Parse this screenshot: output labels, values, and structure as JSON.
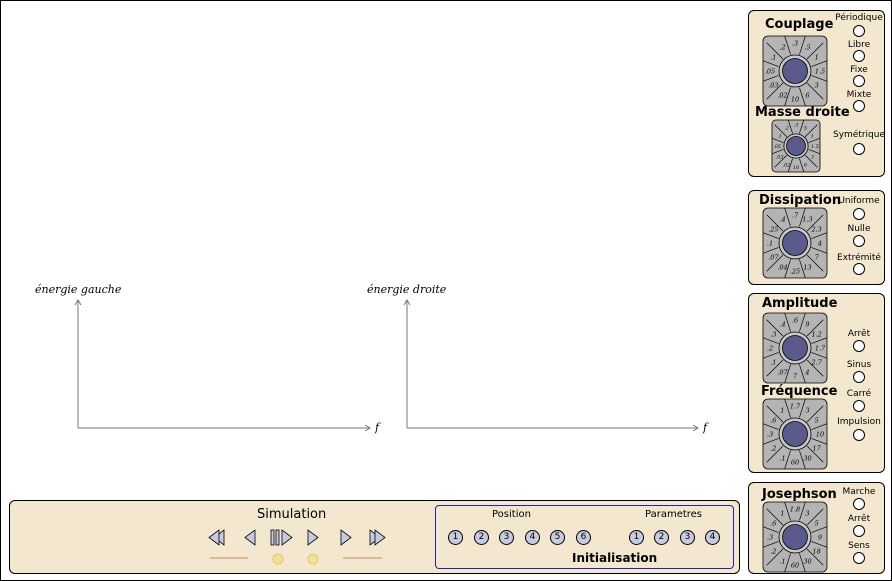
{
  "graphs": {
    "left": {
      "ylabel": "énergie gauche",
      "xlabel": "f"
    },
    "right": {
      "ylabel": "énergie droite",
      "xlabel": "f"
    }
  },
  "couplage_panel": {
    "title": "Couplage",
    "title2": "Masse droite",
    "options": [
      "Périodique",
      "Libre",
      "Fixe",
      "Mixte",
      "Symétrique"
    ]
  },
  "dissipation_panel": {
    "title": "Dissipation",
    "options": [
      "Uniforme",
      "Nulle",
      "Extrémité"
    ]
  },
  "amplitude_panel": {
    "title": "Amplitude",
    "title2": "Fréquence",
    "options": [
      "Arrêt",
      "Sinus",
      "Carré",
      "Impulsion"
    ]
  },
  "josephson_panel": {
    "title": "Josephson",
    "options": [
      "Marche",
      "Arrêt",
      "Sens"
    ]
  },
  "knobs": {
    "couplage": [
      ".5",
      "1",
      "1.5",
      "3",
      "6",
      "10",
      ".02",
      ".03",
      ".05",
      ".1",
      ".2",
      ".3"
    ],
    "masse": [
      "5",
      "1",
      "1.5",
      "3",
      "6",
      "10",
      ".02",
      ".03",
      ".05",
      ".1",
      ".2",
      ".3"
    ],
    "dissipation": [
      "1.3",
      "2.3",
      "4",
      "7",
      "13",
      ".25",
      ".04",
      ".07",
      ".1",
      ".25",
      ".4",
      ".7"
    ],
    "amplitude": [
      "9",
      "1.2",
      "1.7",
      "2.7",
      "4",
      "7",
      ".07",
      ".1",
      ".2",
      ".3",
      ".4",
      ".6"
    ],
    "frequence": [
      "3",
      "5",
      "10",
      "17",
      "30",
      "60",
      ".1",
      ".2",
      ".3",
      ".6",
      "1",
      "1.7"
    ],
    "josephson": [
      "3",
      "5",
      "9",
      "18",
      "30",
      "60",
      ".1",
      ".2",
      ".3",
      ".6",
      "1",
      "1.8"
    ]
  },
  "simulation": {
    "title": "Simulation",
    "init_title": "Initialisation",
    "position_label": "Position",
    "parametres_label": "Parametres",
    "position_buttons": [
      "1",
      "2",
      "3",
      "4",
      "5",
      "6"
    ],
    "parametres_buttons": [
      "1",
      "2",
      "3",
      "4"
    ]
  },
  "colors": {
    "panel_bg": "#f3e8cf",
    "knob_face": "#b4b4b4",
    "knob_center": "#5a5a8c",
    "button_fill": "#c8cadf",
    "init_border": "#2222aa"
  }
}
